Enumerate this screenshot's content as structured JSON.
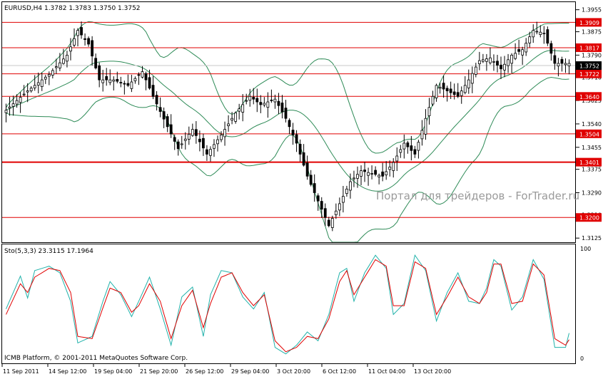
{
  "header": {
    "symbol_line": "EURUSD,H4  1.3782 1.3783 1.3750 1.3752"
  },
  "stochastic": {
    "label": "Sto(5,3,3) 23.3115 17.1964"
  },
  "footer": {
    "copyright": "ICMB Platform, © 2001-2011 MetaQuotes Software Corp."
  },
  "watermark": "Портал для трейдеров - ForTrader.ru",
  "colors": {
    "background": "#ffffff",
    "candle": "#000000",
    "bollinger": "#2e8b57",
    "level_line": "#e00000",
    "price_tag_bg": "#e00000",
    "current_tag_bg": "#000000",
    "stoch_main": "#20b2aa",
    "stoch_signal": "#e00000",
    "grid": "#c8c8c8",
    "watermark": "#9a9a9a"
  },
  "chart_data": [
    {
      "type": "candlestick",
      "symbol": "EURUSD",
      "timeframe": "H4",
      "title": "EURUSD,H4",
      "ohlc_last": {
        "open": 1.3782,
        "high": 1.3783,
        "low": 1.375,
        "close": 1.3752
      },
      "current_price": "1.3752",
      "y_ticks": [
        "1.3955",
        "1.3875",
        "1.3790",
        "1.3710",
        "1.3625",
        "1.3540",
        "1.3455",
        "1.3375",
        "1.3290",
        "1.3210",
        "1.3125"
      ],
      "ylim": [
        1.311,
        1.398
      ],
      "x_ticks": [
        "11 Sep 2011",
        "14 Sep 12:00",
        "19 Sep 04:00",
        "21 Sep 20:00",
        "26 Sep 12:00",
        "29 Sep 04:00",
        "3 Oct 20:00",
        "6 Oct 12:00",
        "11 Oct 04:00",
        "13 Oct 20:00"
      ],
      "levels": [
        {
          "value": 1.3909,
          "label": "1.3909"
        },
        {
          "value": 1.3817,
          "label": "1.3817"
        },
        {
          "value": 1.3722,
          "label": "1.3722"
        },
        {
          "value": 1.364,
          "label": "1.3640"
        },
        {
          "value": 1.3504,
          "label": "1.3504"
        },
        {
          "value": 1.3401,
          "label": "1.3401"
        },
        {
          "value": 1.32,
          "label": "1.3200"
        }
      ],
      "close_path": [
        [
          0,
          1.359
        ],
        [
          6,
          1.366
        ],
        [
          12,
          1.372
        ],
        [
          17,
          1.379
        ],
        [
          20,
          1.388
        ],
        [
          23,
          1.383
        ],
        [
          26,
          1.37
        ],
        [
          30,
          1.37
        ],
        [
          34,
          1.368
        ],
        [
          38,
          1.373
        ],
        [
          41,
          1.364
        ],
        [
          45,
          1.353
        ],
        [
          48,
          1.345
        ],
        [
          52,
          1.352
        ],
        [
          56,
          1.343
        ],
        [
          60,
          1.35
        ],
        [
          64,
          1.358
        ],
        [
          68,
          1.364
        ],
        [
          71,
          1.361
        ],
        [
          75,
          1.363
        ],
        [
          78,
          1.356
        ],
        [
          81,
          1.347
        ],
        [
          84,
          1.335
        ],
        [
          87,
          1.326
        ],
        [
          90,
          1.317
        ],
        [
          93,
          1.325
        ],
        [
          96,
          1.333
        ],
        [
          99,
          1.337
        ],
        [
          102,
          1.336
        ],
        [
          105,
          1.335
        ],
        [
          108,
          1.34
        ],
        [
          111,
          1.347
        ],
        [
          114,
          1.343
        ],
        [
          117,
          1.356
        ],
        [
          120,
          1.368
        ],
        [
          123,
          1.366
        ],
        [
          126,
          1.364
        ],
        [
          129,
          1.37
        ],
        [
          132,
          1.377
        ],
        [
          135,
          1.378
        ],
        [
          138,
          1.374
        ],
        [
          141,
          1.379
        ],
        [
          144,
          1.381
        ],
        [
          147,
          1.388
        ],
        [
          150,
          1.387
        ],
        [
          153,
          1.376
        ],
        [
          157,
          1.376
        ]
      ]
    },
    {
      "type": "line",
      "title": "Sto(5,3,3)",
      "values_shown": {
        "main": 23.3115,
        "signal": 17.1964
      },
      "y_ticks": [
        "100",
        "0"
      ],
      "ylim": [
        0,
        100
      ],
      "main_path": [
        [
          0,
          45
        ],
        [
          4,
          75
        ],
        [
          6,
          55
        ],
        [
          8,
          80
        ],
        [
          12,
          84
        ],
        [
          15,
          78
        ],
        [
          18,
          52
        ],
        [
          20,
          14
        ],
        [
          24,
          20
        ],
        [
          27,
          52
        ],
        [
          29,
          70
        ],
        [
          32,
          58
        ],
        [
          35,
          38
        ],
        [
          37,
          52
        ],
        [
          40,
          74
        ],
        [
          43,
          45
        ],
        [
          46,
          12
        ],
        [
          49,
          56
        ],
        [
          52,
          65
        ],
        [
          55,
          20
        ],
        [
          57,
          58
        ],
        [
          60,
          80
        ],
        [
          63,
          78
        ],
        [
          66,
          56
        ],
        [
          69,
          45
        ],
        [
          72,
          60
        ],
        [
          75,
          10
        ],
        [
          78,
          4
        ],
        [
          81,
          12
        ],
        [
          84,
          24
        ],
        [
          87,
          16
        ],
        [
          90,
          40
        ],
        [
          93,
          78
        ],
        [
          95,
          82
        ],
        [
          97,
          52
        ],
        [
          100,
          78
        ],
        [
          103,
          94
        ],
        [
          106,
          82
        ],
        [
          108,
          40
        ],
        [
          111,
          50
        ],
        [
          114,
          94
        ],
        [
          117,
          80
        ],
        [
          120,
          34
        ],
        [
          123,
          60
        ],
        [
          126,
          78
        ],
        [
          129,
          52
        ],
        [
          132,
          50
        ],
        [
          134,
          64
        ],
        [
          136,
          90
        ],
        [
          138,
          84
        ],
        [
          141,
          44
        ],
        [
          144,
          56
        ],
        [
          147,
          90
        ],
        [
          150,
          72
        ],
        [
          153,
          10
        ],
        [
          156,
          10
        ],
        [
          157,
          23
        ]
      ],
      "signal_path": [
        [
          0,
          40
        ],
        [
          4,
          68
        ],
        [
          6,
          60
        ],
        [
          8,
          74
        ],
        [
          12,
          82
        ],
        [
          15,
          80
        ],
        [
          18,
          60
        ],
        [
          20,
          20
        ],
        [
          24,
          18
        ],
        [
          27,
          46
        ],
        [
          29,
          64
        ],
        [
          32,
          60
        ],
        [
          35,
          42
        ],
        [
          37,
          48
        ],
        [
          40,
          68
        ],
        [
          43,
          52
        ],
        [
          46,
          18
        ],
        [
          49,
          48
        ],
        [
          52,
          62
        ],
        [
          55,
          28
        ],
        [
          57,
          50
        ],
        [
          60,
          74
        ],
        [
          63,
          78
        ],
        [
          66,
          60
        ],
        [
          69,
          48
        ],
        [
          72,
          58
        ],
        [
          75,
          16
        ],
        [
          78,
          6
        ],
        [
          81,
          10
        ],
        [
          84,
          20
        ],
        [
          87,
          18
        ],
        [
          90,
          36
        ],
        [
          93,
          70
        ],
        [
          95,
          80
        ],
        [
          97,
          58
        ],
        [
          100,
          74
        ],
        [
          103,
          90
        ],
        [
          106,
          84
        ],
        [
          108,
          48
        ],
        [
          111,
          48
        ],
        [
          114,
          88
        ],
        [
          117,
          82
        ],
        [
          120,
          40
        ],
        [
          123,
          56
        ],
        [
          126,
          74
        ],
        [
          129,
          56
        ],
        [
          132,
          50
        ],
        [
          134,
          60
        ],
        [
          136,
          86
        ],
        [
          138,
          86
        ],
        [
          141,
          50
        ],
        [
          144,
          52
        ],
        [
          147,
          86
        ],
        [
          150,
          76
        ],
        [
          153,
          18
        ],
        [
          156,
          12
        ],
        [
          157,
          17
        ]
      ]
    }
  ]
}
